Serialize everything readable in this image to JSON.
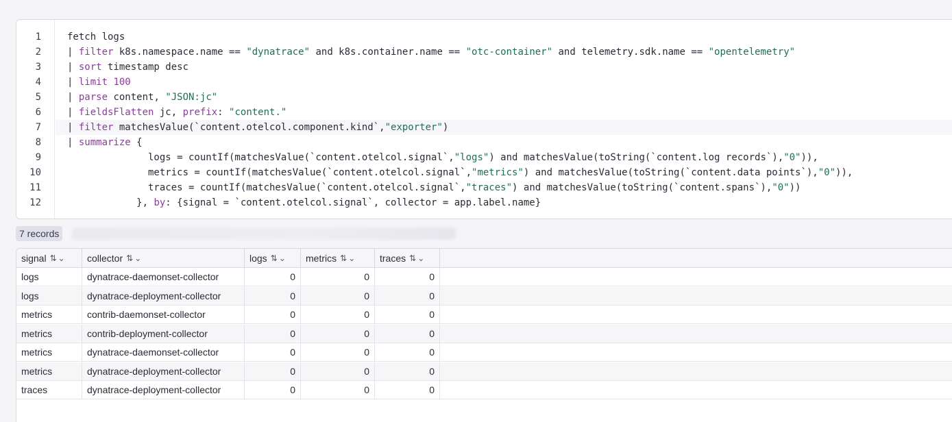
{
  "editor": {
    "line_numbers": [
      "1",
      "2",
      "3",
      "4",
      "5",
      "6",
      "7",
      "8",
      "9",
      "10",
      "11",
      "12"
    ],
    "lines": [
      [
        {
          "t": "fetch logs",
          "c": ""
        }
      ],
      [
        {
          "t": "| ",
          "c": ""
        },
        {
          "t": "filter",
          "c": "kw"
        },
        {
          "t": " k8s.namespace.name == ",
          "c": ""
        },
        {
          "t": "\"dynatrace\"",
          "c": "str"
        },
        {
          "t": " and k8s.container.name == ",
          "c": ""
        },
        {
          "t": "\"otc-container\"",
          "c": "str"
        },
        {
          "t": " and telemetry.sdk.name == ",
          "c": ""
        },
        {
          "t": "\"opentelemetry\"",
          "c": "str"
        }
      ],
      [
        {
          "t": "| ",
          "c": ""
        },
        {
          "t": "sort",
          "c": "kw"
        },
        {
          "t": " timestamp desc",
          "c": ""
        }
      ],
      [
        {
          "t": "| ",
          "c": ""
        },
        {
          "t": "limit",
          "c": "kw"
        },
        {
          "t": " ",
          "c": ""
        },
        {
          "t": "100",
          "c": "num"
        }
      ],
      [
        {
          "t": "| ",
          "c": ""
        },
        {
          "t": "parse",
          "c": "kw"
        },
        {
          "t": " content, ",
          "c": ""
        },
        {
          "t": "\"JSON:jc\"",
          "c": "str"
        }
      ],
      [
        {
          "t": "| ",
          "c": ""
        },
        {
          "t": "fieldsFlatten",
          "c": "kw"
        },
        {
          "t": " jc, ",
          "c": ""
        },
        {
          "t": "prefix",
          "c": "kw"
        },
        {
          "t": ": ",
          "c": ""
        },
        {
          "t": "\"content.\"",
          "c": "str"
        }
      ],
      [
        {
          "t": "| ",
          "c": ""
        },
        {
          "t": "filter",
          "c": "kw"
        },
        {
          "t": " matchesValue(`content.otelcol.component.kind`,",
          "c": ""
        },
        {
          "t": "\"exporter\"",
          "c": "str"
        },
        {
          "t": ")",
          "c": ""
        }
      ],
      [
        {
          "t": "| ",
          "c": ""
        },
        {
          "t": "summarize",
          "c": "kw"
        },
        {
          "t": " {",
          "c": ""
        }
      ],
      [
        {
          "t": "              logs = countIf(matchesValue(`content.otelcol.signal`,",
          "c": ""
        },
        {
          "t": "\"logs\"",
          "c": "str"
        },
        {
          "t": ") and matchesValue(toString(`content.log records`),",
          "c": ""
        },
        {
          "t": "\"0\"",
          "c": "str"
        },
        {
          "t": ")),",
          "c": ""
        }
      ],
      [
        {
          "t": "              metrics = countIf(matchesValue(`content.otelcol.signal`,",
          "c": ""
        },
        {
          "t": "\"metrics\"",
          "c": "str"
        },
        {
          "t": ") and matchesValue(toString(`content.data points`),",
          "c": ""
        },
        {
          "t": "\"0\"",
          "c": "str"
        },
        {
          "t": ")),",
          "c": ""
        }
      ],
      [
        {
          "t": "              traces = countIf(matchesValue(`content.otelcol.signal`,",
          "c": ""
        },
        {
          "t": "\"traces\"",
          "c": "str"
        },
        {
          "t": ") and matchesValue(toString(`content.spans`),",
          "c": ""
        },
        {
          "t": "\"0\"",
          "c": "str"
        },
        {
          "t": "))",
          "c": ""
        }
      ],
      [
        {
          "t": "            }, ",
          "c": ""
        },
        {
          "t": "by",
          "c": "kw"
        },
        {
          "t": ": {signal = `content.otelcol.signal`, collector = app.label.name}",
          "c": ""
        }
      ]
    ]
  },
  "results": {
    "records_label": "7 records",
    "columns": [
      "signal",
      "collector",
      "logs",
      "metrics",
      "traces"
    ],
    "rows": [
      [
        "logs",
        "dynatrace-daemonset-collector",
        "0",
        "0",
        "0"
      ],
      [
        "logs",
        "dynatrace-deployment-collector",
        "0",
        "0",
        "0"
      ],
      [
        "metrics",
        "contrib-daemonset-collector",
        "0",
        "0",
        "0"
      ],
      [
        "metrics",
        "contrib-deployment-collector",
        "0",
        "0",
        "0"
      ],
      [
        "metrics",
        "dynatrace-daemonset-collector",
        "0",
        "0",
        "0"
      ],
      [
        "metrics",
        "dynatrace-deployment-collector",
        "0",
        "0",
        "0"
      ],
      [
        "traces",
        "dynatrace-deployment-collector",
        "0",
        "0",
        "0"
      ]
    ]
  },
  "icons": {
    "sort": "sort-icon",
    "menu": "chevron-down-icon"
  }
}
